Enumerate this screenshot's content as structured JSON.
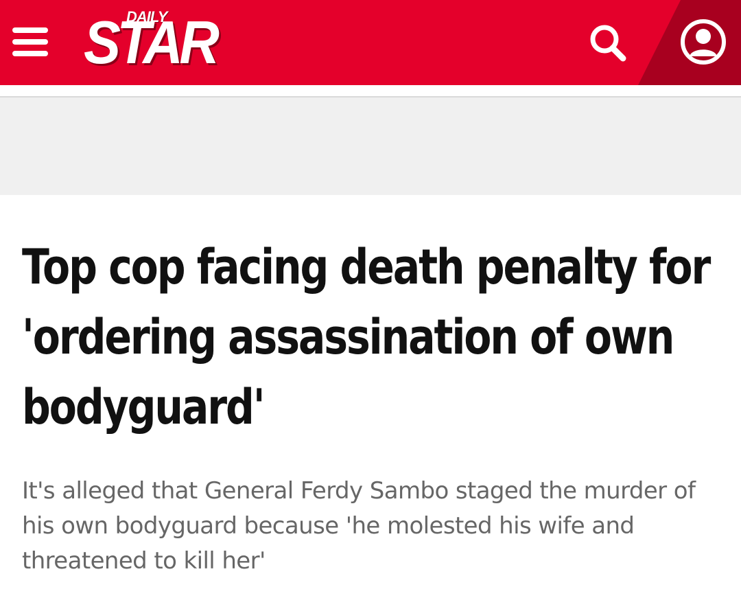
{
  "header": {
    "brand_color": "#e4002b",
    "accent_dark": "#a8001f",
    "logo_top": "DAILY",
    "logo_main": "STAR",
    "menu_icon": "hamburger-icon",
    "search_icon": "search-icon",
    "account_icon": "user-account-icon"
  },
  "ad_slot": {
    "background": "#f0f0f0"
  },
  "article": {
    "headline": "Top cop facing death penalty for 'ordering assassination of own bodyguard'",
    "standfirst": "It's alleged that General Ferdy Sambo staged the murder of his own bodyguard because 'he molested his wife and threatened to kill her'"
  }
}
